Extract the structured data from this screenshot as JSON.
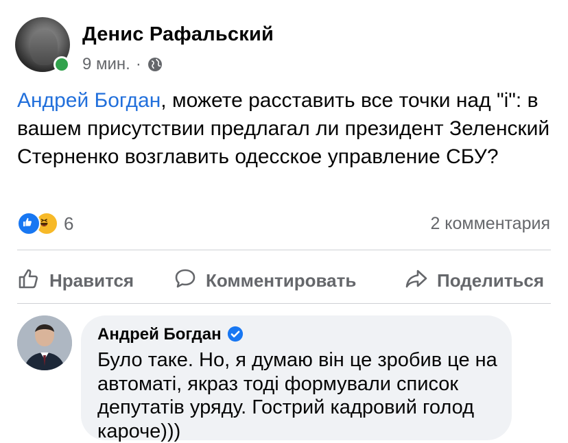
{
  "post": {
    "author": "Денис Рафальский",
    "time": "9 мин.",
    "separator": "·",
    "privacy_icon": "globe-icon",
    "mention": "Андрей Богдан",
    "text": ", можете расставить все точки над \"і\": в вашем присутствии предлагал ли президент Зеленский Стерненко возглавить одесское управление СБУ?",
    "reaction_icons": [
      "like-icon",
      "haha-icon"
    ],
    "reaction_count": "6",
    "comments_count": "2 комментария"
  },
  "actions": {
    "like": "Нравится",
    "comment": "Комментировать",
    "share": "Поделиться"
  },
  "comment": {
    "author": "Андрей Богдан",
    "verified_icon": "verified-badge-icon",
    "text": "Було таке. Но, я думаю він це зробив це на автоматі, якраз тоді формували список депутатів уряду. Гострий кадровий голод кароче)))"
  },
  "colors": {
    "mention": "#216fdb",
    "online": "#31a24c",
    "like": "#1877f2",
    "haha": "#f7b928",
    "secondary_text": "#65676b",
    "bubble": "#f0f2f5"
  }
}
